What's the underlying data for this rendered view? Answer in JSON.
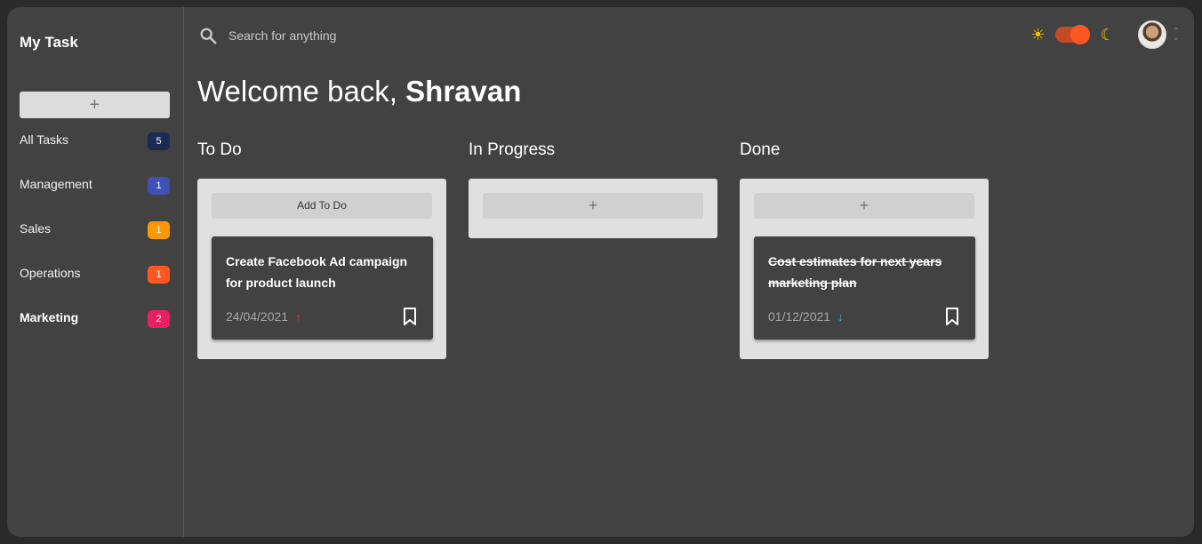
{
  "app": {
    "title": "My Task"
  },
  "sidebar": {
    "add_label": "+",
    "items": [
      {
        "label": "All Tasks",
        "count": "5",
        "color": "#1b2a52"
      },
      {
        "label": "Management",
        "count": "1",
        "color": "#3f51b5"
      },
      {
        "label": "Sales",
        "count": "1",
        "color": "#ff9800"
      },
      {
        "label": "Operations",
        "count": "1",
        "color": "#ff5722"
      },
      {
        "label": "Marketing",
        "count": "2",
        "color": "#e91e63"
      }
    ]
  },
  "header": {
    "search_placeholder": "Search for anything",
    "theme_light_icon": "sun-icon",
    "theme_dark_icon": "moon-icon"
  },
  "welcome": {
    "prefix": "Welcome back, ",
    "name": "Shravan"
  },
  "columns": [
    {
      "title": "To Do",
      "add_label": "Add To Do",
      "cards": [
        {
          "title": "Create Facebook Ad campaign for product launch",
          "date": "24/04/2021",
          "priority": "high"
        }
      ]
    },
    {
      "title": "In Progress",
      "add_label": "+",
      "cards": []
    },
    {
      "title": "Done",
      "add_label": "+",
      "cards": [
        {
          "title": "Cost estimates for next years marketing plan",
          "date": "01/12/2021",
          "priority": "low"
        }
      ]
    }
  ],
  "colors": {
    "accent": "#ff5722",
    "priority_high": "#e53935",
    "priority_low": "#26c6da"
  }
}
